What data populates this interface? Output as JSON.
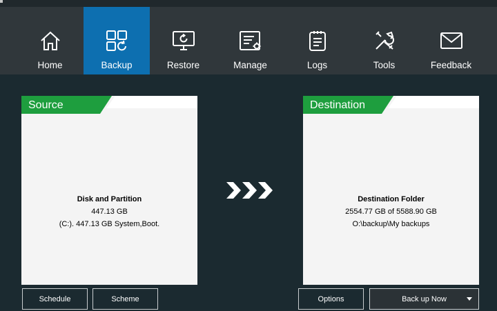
{
  "nav": [
    {
      "label": "Home",
      "icon": "home-icon"
    },
    {
      "label": "Backup",
      "icon": "backup-icon",
      "active": true
    },
    {
      "label": "Restore",
      "icon": "restore-icon"
    },
    {
      "label": "Manage",
      "icon": "manage-icon"
    },
    {
      "label": "Logs",
      "icon": "logs-icon"
    },
    {
      "label": "Tools",
      "icon": "tools-icon"
    },
    {
      "label": "Feedback",
      "icon": "feedback-icon"
    }
  ],
  "source": {
    "title": "Source",
    "heading": "Disk and Partition",
    "size": "447.13 GB",
    "detail": "(C:). 447.13 GB System,Boot."
  },
  "destination": {
    "title": "Destination",
    "heading": "Destination Folder",
    "space": "2554.77 GB of 5588.90 GB",
    "path": "O:\\backup\\My backups"
  },
  "buttons": {
    "schedule": "Schedule",
    "scheme": "Scheme",
    "options": "Options",
    "backup_now": "Back up Now"
  },
  "colors": {
    "accent": "#0d6fb0",
    "header_green": "#1e9e3e",
    "background": "#1b2a30",
    "toolbar": "#30373b"
  },
  "arrow_icon": "triple-chevron-right-icon"
}
